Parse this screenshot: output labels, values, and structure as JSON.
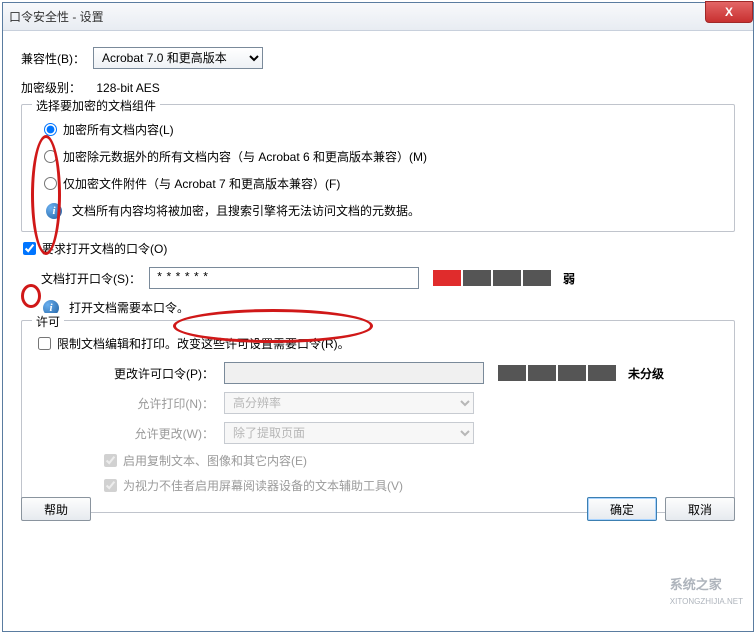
{
  "window": {
    "title": "口令安全性 - 设置",
    "close_label": "X"
  },
  "compat": {
    "label": "兼容性(B)：",
    "value": "Acrobat 7.0 和更高版本"
  },
  "enc_level": {
    "label": "加密级别：",
    "value": "128-bit AES"
  },
  "group_encrypt": {
    "legend": "选择要加密的文档组件",
    "opt_all": "加密所有文档内容(L)",
    "opt_except_meta": "加密除元数据外的所有文档内容（与 Acrobat 6 和更高版本兼容）(M)",
    "opt_attach_only": "仅加密文件附件（与 Acrobat 7 和更高版本兼容）(F)",
    "info": "文档所有内容均将被加密，且搜索引擎将无法访问文档的元数据。"
  },
  "open_pw_check": "要求打开文档的口令(O)",
  "open_pw": {
    "label": "文档打开口令(S)：",
    "value": "******",
    "strength_label": "弱",
    "info": "打开文档需要本口令。"
  },
  "group_perm": {
    "legend": "许可",
    "restrict": "限制文档编辑和打印。改变这些许可设置需要口令(R)。",
    "change_pw_label": "更改许可口令(P)：",
    "change_pw_value": "",
    "strength_label": "未分级",
    "allow_print_label": "允许打印(N)：",
    "allow_print_value": "高分辨率",
    "allow_change_label": "允许更改(W)：",
    "allow_change_value": "除了提取页面",
    "enable_copy": "启用复制文本、图像和其它内容(E)",
    "enable_screenreader": "为视力不佳者启用屏幕阅读器设备的文本辅助工具(V)"
  },
  "footer": {
    "help": "帮助",
    "ok": "确定",
    "cancel": "取消"
  },
  "watermark": {
    "brand": "系统之家",
    "url": "XITONGZHIJIA.NET"
  }
}
